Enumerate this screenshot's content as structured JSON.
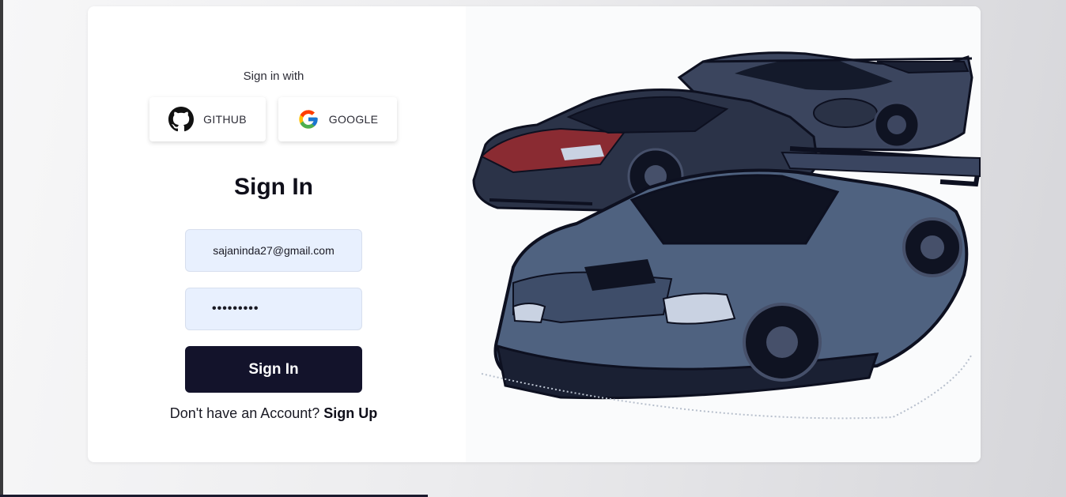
{
  "login": {
    "sign_in_with": "Sign in with",
    "github_label": "GITHUB",
    "google_label": "GOOGLE",
    "title": "Sign In",
    "email_value": "sajaninda27@gmail.com",
    "password_mask": "•••••••••",
    "submit_label": "Sign In",
    "no_account_text": "Don't have an Account?",
    "signup_label": "Sign Up"
  },
  "illustration": {
    "icon": "sports-cars-illustration",
    "colors": {
      "body_dark": "#2b3348",
      "body_light": "#4f6280",
      "accent_red": "#8a2b32",
      "outline": "#0d1020"
    }
  },
  "theme": {
    "button_bg": "#13132b",
    "field_bg": "#e8f0fe"
  }
}
